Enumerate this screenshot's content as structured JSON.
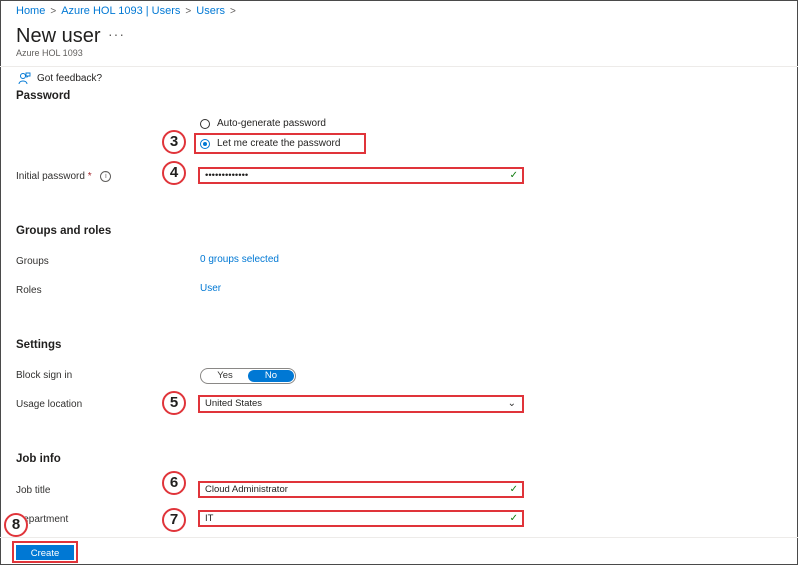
{
  "breadcrumb": [
    "Home",
    "Azure HOL 1093 | Users",
    "Users"
  ],
  "header": {
    "title": "New user",
    "more": "···",
    "subtitle": "Azure HOL 1093"
  },
  "toolbar": {
    "feedback_label": "Got feedback?"
  },
  "password": {
    "section_title": "Password",
    "options": [
      {
        "label": "Auto-generate password",
        "selected": false
      },
      {
        "label": "Let me create the password",
        "selected": true
      }
    ],
    "initial_label": "Initial password",
    "required_mark": "*",
    "value": "•••••••••••••",
    "info_icon": "i"
  },
  "groups_roles": {
    "section_title": "Groups and roles",
    "groups_label": "Groups",
    "groups_value": "0 groups selected",
    "roles_label": "Roles",
    "roles_value": "User"
  },
  "settings": {
    "section_title": "Settings",
    "block_label": "Block sign in",
    "toggle_yes": "Yes",
    "toggle_no": "No",
    "toggle_selected": "No",
    "usage_label": "Usage location",
    "usage_value": "United States"
  },
  "job_info": {
    "section_title": "Job info",
    "job_title_label": "Job title",
    "job_title_value": "Cloud Administrator",
    "department_label": "Department",
    "department_value": "IT"
  },
  "steps": [
    "3",
    "4",
    "5",
    "6",
    "7",
    "8"
  ],
  "footer": {
    "create_label": "Create"
  },
  "colors": {
    "accent": "#0078d4",
    "highlight": "#e0343a",
    "valid": "#107c10"
  },
  "icons": {
    "feedback": "person-feedback-icon",
    "check": "checkmark-icon",
    "dropdown": "chevron-down-icon",
    "info": "info-icon"
  }
}
